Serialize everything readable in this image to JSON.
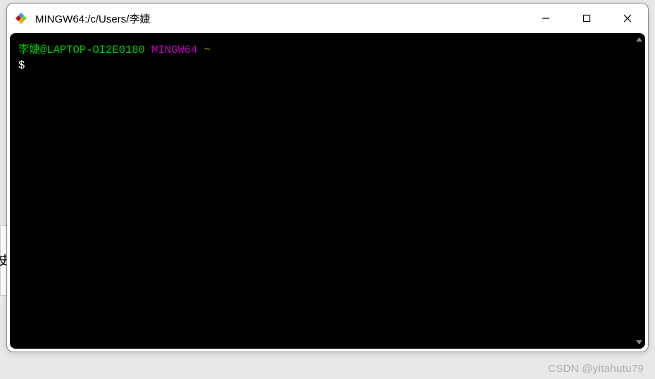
{
  "window": {
    "title": "MINGW64:/c/Users/李婕"
  },
  "terminal": {
    "prompt": {
      "user": "李婕",
      "at": "@",
      "host": "LAPTOP-OI2E0180",
      "space1": " ",
      "env": "MINGW64",
      "space2": " ",
      "path": "~"
    },
    "symbol": "$"
  },
  "watermark": "CSDN @yitahutu79",
  "backdrop_char": "史"
}
